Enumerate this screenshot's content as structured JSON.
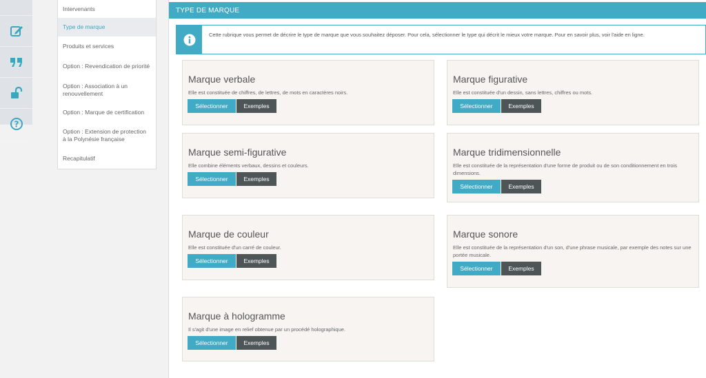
{
  "colors": {
    "accent": "#41aac4",
    "dark_button": "#4e5557",
    "card_bg": "#f7f4f1"
  },
  "rail": {
    "icons": [
      "edit-icon",
      "quote-icon",
      "unlock-icon",
      "help-icon"
    ]
  },
  "steps": [
    {
      "label": "Intervenants",
      "active": false
    },
    {
      "label": "Type de marque",
      "active": true
    },
    {
      "label": "Produits et services",
      "active": false
    },
    {
      "label": "Option : Revendication de priorité",
      "active": false
    },
    {
      "label": "Option : Association à un renouvellement",
      "active": false
    },
    {
      "label": "Option : Marque de certification",
      "active": false
    },
    {
      "label": "Option : Extension de protection à la Polynésie française",
      "active": false
    },
    {
      "label": "Recapitulatif",
      "active": false
    }
  ],
  "main": {
    "header": "TYPE DE MARQUE",
    "info": "Cette rubrique vous permet de décrire le type de marque que vous souhaitez déposer. Pour cela, sélectionner le type qui décrit le mieux votre marque. Pour en savoir plus, voir l'aide en ligne."
  },
  "buttons": {
    "select": "Sélectionner",
    "examples": "Exemples"
  },
  "cards": [
    {
      "title": "Marque verbale",
      "desc": "Elle est constituée de chiffres, de lettres, de mots en caractères noirs."
    },
    {
      "title": "Marque figurative",
      "desc": "Elle est constituée d'un dessin, sans lettres, chiffres ou mots."
    },
    {
      "title": "Marque semi-figurative",
      "desc": "Elle combine éléments verbaux, dessins et couleurs."
    },
    {
      "title": "Marque tridimensionnelle",
      "desc": "Elle est constituée de la représentation d'une forme de produit ou de son conditionnement en trois dimensions."
    },
    {
      "title": "Marque de couleur",
      "desc": "Elle est constituée d'un carré de couleur."
    },
    {
      "title": "Marque sonore",
      "desc": "Elle est constituée de la représentation d'un son, d'une phrase musicale, par exemple des notes sur une portée musicale."
    },
    {
      "title": "Marque à hologramme",
      "desc": "Il s'agit d'une image en relief obtenue par un procédé holographique."
    }
  ]
}
